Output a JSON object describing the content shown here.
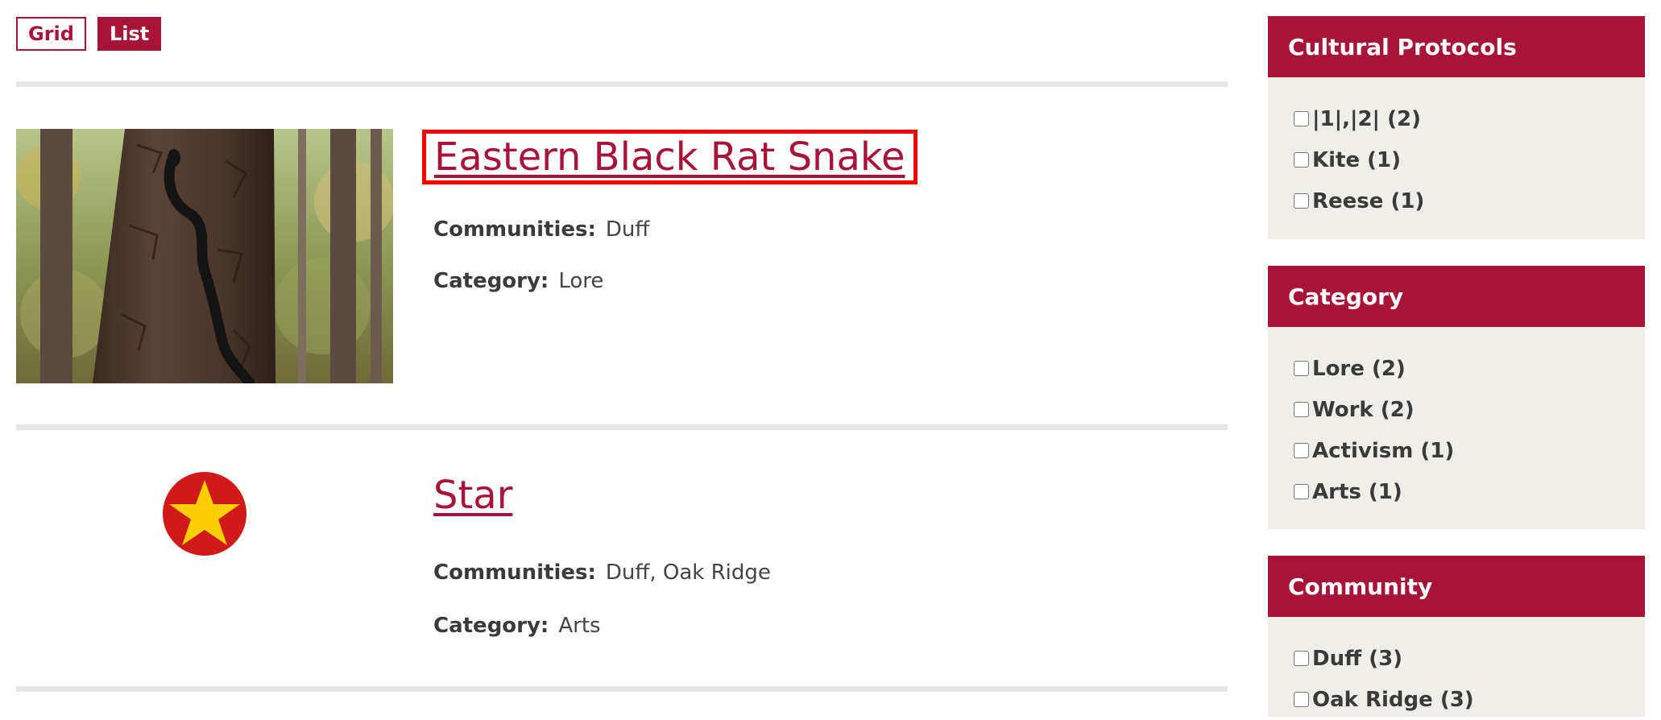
{
  "view_toggle": {
    "grid_label": "Grid",
    "list_label": "List"
  },
  "results": [
    {
      "title": "Eastern Black Rat Snake",
      "communities_label": "Communities:",
      "communities": "Duff",
      "category_label": "Category:",
      "category": "Lore",
      "thumbnail": "snake-on-tree-photo"
    },
    {
      "title": "Star",
      "communities_label": "Communities:",
      "communities": "Duff, Oak Ridge",
      "category_label": "Category:",
      "category": "Arts",
      "thumbnail": "red-circle-yellow-star-icon"
    }
  ],
  "facets": [
    {
      "title": "Cultural Protocols",
      "options": [
        "|1|,|2| (2)",
        "Kite (1)",
        "Reese (1)"
      ]
    },
    {
      "title": "Category",
      "options": [
        "Lore (2)",
        "Work (2)",
        "Activism (1)",
        "Arts (1)"
      ]
    },
    {
      "title": "Community",
      "options": [
        "Duff (3)",
        "Oak Ridge (3)"
      ]
    }
  ],
  "colors": {
    "accent": "#a8133a",
    "highlight_border": "#ff0000",
    "facet_bg": "#efeee9",
    "divider": "#e6e6e6"
  }
}
